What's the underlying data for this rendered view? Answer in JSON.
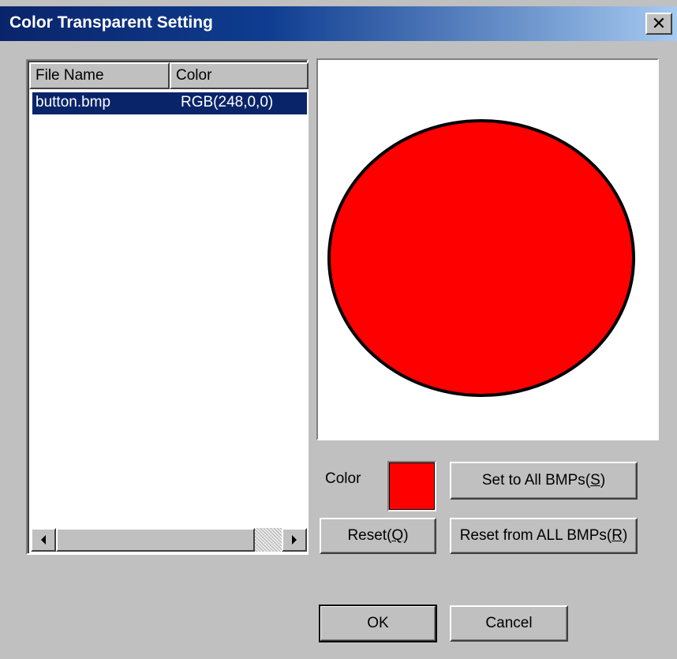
{
  "window": {
    "title": "Color Transparent Setting",
    "close_glyph": "✕"
  },
  "list": {
    "columns": [
      "File Name",
      "Color"
    ],
    "rows": [
      {
        "file_name": "button.bmp",
        "color": "RGB(248,0,0)",
        "selected": true
      }
    ]
  },
  "preview": {
    "shape": "circle",
    "fill_color": "#ff0000",
    "outline_color": "#000000"
  },
  "color_section": {
    "label": "Color",
    "swatch_color": "#ff0000"
  },
  "buttons": {
    "set_all": {
      "prefix": "Set to All BMPs(",
      "mnemonic": "S",
      "suffix": ")"
    },
    "reset": {
      "prefix": "Reset(",
      "mnemonic": "Q",
      "suffix": ")"
    },
    "reset_all": {
      "prefix": "Reset from ALL BMPs(",
      "mnemonic": "R",
      "suffix": ")"
    },
    "ok": "OK",
    "cancel": "Cancel"
  },
  "icons": {
    "scroll_left": "scroll-left-arrow-icon",
    "scroll_right": "scroll-right-arrow-icon",
    "close": "close-icon"
  }
}
